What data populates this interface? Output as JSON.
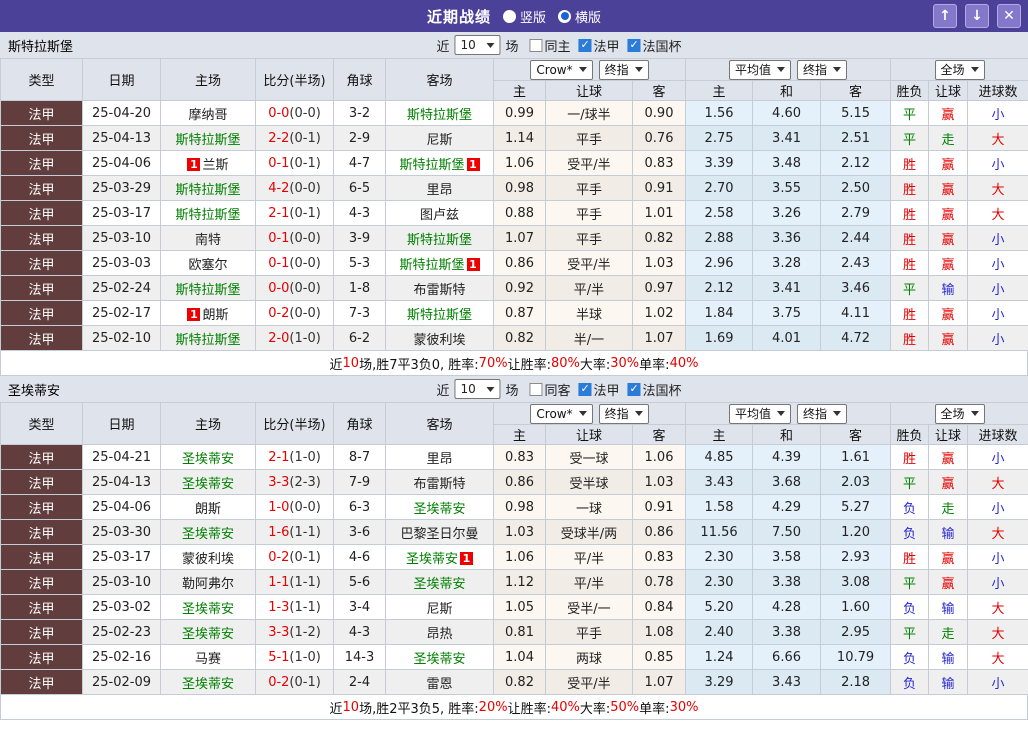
{
  "titlebar": {
    "title": "近期战绩",
    "layout_options": [
      {
        "label": "竖版",
        "selected": false
      },
      {
        "label": "横版",
        "selected": true
      }
    ],
    "buttons": {
      "up": "↑",
      "down": "↓",
      "close": "✕"
    }
  },
  "palette": {
    "accent_purple": "#4c4199",
    "type_maroon": "#613d3d",
    "win_red": "#e60000",
    "draw_green": "#008000",
    "lose_blue": "#2727d2",
    "highlight_team_green": "#008000"
  },
  "color_map": {
    "胜": "red",
    "平": "green",
    "负": "blue",
    "赢": "red",
    "走": "green",
    "输": "blue",
    "大": "red",
    "小": "blue"
  },
  "table_header": {
    "col_type": "类型",
    "col_date": "日期",
    "col_home": "主场",
    "col_score": "比分(半场)",
    "col_corner": "角球",
    "col_away": "客场",
    "sub_home": "主",
    "sub_handicap": "让球",
    "sub_away": "客",
    "sub_avg_home": "主",
    "sub_avg_draw": "和",
    "sub_avg_away": "客",
    "col_result": "胜负",
    "col_asian": "让球",
    "col_goals": "进球数"
  },
  "sections": [
    {
      "team": "斯特拉斯堡",
      "filter": {
        "prefix": "近",
        "count": "10",
        "suffix": "场",
        "checks": [
          {
            "label": "同主",
            "checked": false
          },
          {
            "label": "法甲",
            "checked": true
          },
          {
            "label": "法国杯",
            "checked": true
          }
        ]
      },
      "selects": {
        "crow": "Crow*",
        "crow_kind": "终指",
        "avg": "平均值",
        "avg_kind": "终指",
        "scope": "全场"
      },
      "rows": [
        {
          "type": "法甲",
          "date": "25-04-20",
          "home": "摩纳哥",
          "home_hl": false,
          "home_badge": "",
          "score": "0-0",
          "half": "(0-0)",
          "corner": "3-2",
          "away": "斯特拉斯堡",
          "away_hl": true,
          "away_badge": "",
          "h_home": "0.99",
          "handicap": "一/球半",
          "h_away": "0.90",
          "avg_home": "1.56",
          "avg_draw": "4.60",
          "avg_away": "5.15",
          "result": "平",
          "asian": "赢",
          "goals": "小"
        },
        {
          "type": "法甲",
          "date": "25-04-13",
          "home": "斯特拉斯堡",
          "home_hl": true,
          "home_badge": "",
          "score": "2-2",
          "half": "(0-1)",
          "corner": "2-9",
          "away": "尼斯",
          "away_hl": false,
          "away_badge": "",
          "h_home": "1.14",
          "handicap": "平手",
          "h_away": "0.76",
          "avg_home": "2.75",
          "avg_draw": "3.41",
          "avg_away": "2.51",
          "result": "平",
          "asian": "走",
          "goals": "大"
        },
        {
          "type": "法甲",
          "date": "25-04-06",
          "home": "兰斯",
          "home_hl": false,
          "home_badge": "1",
          "score": "0-1",
          "half": "(0-1)",
          "corner": "4-7",
          "away": "斯特拉斯堡",
          "away_hl": true,
          "away_badge": "1",
          "h_home": "1.06",
          "handicap": "受平/半",
          "h_away": "0.83",
          "avg_home": "3.39",
          "avg_draw": "3.48",
          "avg_away": "2.12",
          "result": "胜",
          "asian": "赢",
          "goals": "小"
        },
        {
          "type": "法甲",
          "date": "25-03-29",
          "home": "斯特拉斯堡",
          "home_hl": true,
          "home_badge": "",
          "score": "4-2",
          "half": "(0-0)",
          "corner": "6-5",
          "away": "里昂",
          "away_hl": false,
          "away_badge": "",
          "h_home": "0.98",
          "handicap": "平手",
          "h_away": "0.91",
          "avg_home": "2.70",
          "avg_draw": "3.55",
          "avg_away": "2.50",
          "result": "胜",
          "asian": "赢",
          "goals": "大"
        },
        {
          "type": "法甲",
          "date": "25-03-17",
          "home": "斯特拉斯堡",
          "home_hl": true,
          "home_badge": "",
          "score": "2-1",
          "half": "(0-1)",
          "corner": "4-3",
          "away": "图卢兹",
          "away_hl": false,
          "away_badge": "",
          "h_home": "0.88",
          "handicap": "平手",
          "h_away": "1.01",
          "avg_home": "2.58",
          "avg_draw": "3.26",
          "avg_away": "2.79",
          "result": "胜",
          "asian": "赢",
          "goals": "大"
        },
        {
          "type": "法甲",
          "date": "25-03-10",
          "home": "南特",
          "home_hl": false,
          "home_badge": "",
          "score": "0-1",
          "half": "(0-0)",
          "corner": "3-9",
          "away": "斯特拉斯堡",
          "away_hl": true,
          "away_badge": "",
          "h_home": "1.07",
          "handicap": "平手",
          "h_away": "0.82",
          "avg_home": "2.88",
          "avg_draw": "3.36",
          "avg_away": "2.44",
          "result": "胜",
          "asian": "赢",
          "goals": "小"
        },
        {
          "type": "法甲",
          "date": "25-03-03",
          "home": "欧塞尔",
          "home_hl": false,
          "home_badge": "",
          "score": "0-1",
          "half": "(0-0)",
          "corner": "5-3",
          "away": "斯特拉斯堡",
          "away_hl": true,
          "away_badge": "1",
          "h_home": "0.86",
          "handicap": "受平/半",
          "h_away": "1.03",
          "avg_home": "2.96",
          "avg_draw": "3.28",
          "avg_away": "2.43",
          "result": "胜",
          "asian": "赢",
          "goals": "小"
        },
        {
          "type": "法甲",
          "date": "25-02-24",
          "home": "斯特拉斯堡",
          "home_hl": true,
          "home_badge": "",
          "score": "0-0",
          "half": "(0-0)",
          "corner": "1-8",
          "away": "布雷斯特",
          "away_hl": false,
          "away_badge": "",
          "h_home": "0.92",
          "handicap": "平/半",
          "h_away": "0.97",
          "avg_home": "2.12",
          "avg_draw": "3.41",
          "avg_away": "3.46",
          "result": "平",
          "asian": "输",
          "goals": "小"
        },
        {
          "type": "法甲",
          "date": "25-02-17",
          "home": "朗斯",
          "home_hl": false,
          "home_badge": "1",
          "score": "0-2",
          "half": "(0-0)",
          "corner": "7-3",
          "away": "斯特拉斯堡",
          "away_hl": true,
          "away_badge": "",
          "h_home": "0.87",
          "handicap": "半球",
          "h_away": "1.02",
          "avg_home": "1.84",
          "avg_draw": "3.75",
          "avg_away": "4.11",
          "result": "胜",
          "asian": "赢",
          "goals": "小"
        },
        {
          "type": "法甲",
          "date": "25-02-10",
          "home": "斯特拉斯堡",
          "home_hl": true,
          "home_badge": "",
          "score": "2-0",
          "half": "(1-0)",
          "corner": "6-2",
          "away": "蒙彼利埃",
          "away_hl": false,
          "away_badge": "",
          "h_home": "0.82",
          "handicap": "半/一",
          "h_away": "1.07",
          "avg_home": "1.69",
          "avg_draw": "4.01",
          "avg_away": "4.72",
          "result": "胜",
          "asian": "赢",
          "goals": "小"
        }
      ],
      "summary": [
        {
          "text": "近",
          "color": "black"
        },
        {
          "text": "10",
          "color": "red"
        },
        {
          "text": "场,胜7平3负0, 胜率:",
          "color": "black"
        },
        {
          "text": "70%",
          "color": "red"
        },
        {
          "text": " 让胜率:",
          "color": "black"
        },
        {
          "text": "80%",
          "color": "red"
        },
        {
          "text": " 大率:",
          "color": "black"
        },
        {
          "text": "30%",
          "color": "red"
        },
        {
          "text": " 单率:",
          "color": "black"
        },
        {
          "text": "40%",
          "color": "red"
        }
      ]
    },
    {
      "team": "圣埃蒂安",
      "filter": {
        "prefix": "近",
        "count": "10",
        "suffix": "场",
        "checks": [
          {
            "label": "同客",
            "checked": false
          },
          {
            "label": "法甲",
            "checked": true
          },
          {
            "label": "法国杯",
            "checked": true
          }
        ]
      },
      "selects": {
        "crow": "Crow*",
        "crow_kind": "终指",
        "avg": "平均值",
        "avg_kind": "终指",
        "scope": "全场"
      },
      "rows": [
        {
          "type": "法甲",
          "date": "25-04-21",
          "home": "圣埃蒂安",
          "home_hl": true,
          "home_badge": "",
          "score": "2-1",
          "half": "(1-0)",
          "corner": "8-7",
          "away": "里昂",
          "away_hl": false,
          "away_badge": "",
          "h_home": "0.83",
          "handicap": "受一球",
          "h_away": "1.06",
          "avg_home": "4.85",
          "avg_draw": "4.39",
          "avg_away": "1.61",
          "result": "胜",
          "asian": "赢",
          "goals": "小"
        },
        {
          "type": "法甲",
          "date": "25-04-13",
          "home": "圣埃蒂安",
          "home_hl": true,
          "home_badge": "",
          "score": "3-3",
          "half": "(2-3)",
          "corner": "7-9",
          "away": "布雷斯特",
          "away_hl": false,
          "away_badge": "",
          "h_home": "0.86",
          "handicap": "受半球",
          "h_away": "1.03",
          "avg_home": "3.43",
          "avg_draw": "3.68",
          "avg_away": "2.03",
          "result": "平",
          "asian": "赢",
          "goals": "大"
        },
        {
          "type": "法甲",
          "date": "25-04-06",
          "home": "朗斯",
          "home_hl": false,
          "home_badge": "",
          "score": "1-0",
          "half": "(0-0)",
          "corner": "6-3",
          "away": "圣埃蒂安",
          "away_hl": true,
          "away_badge": "",
          "h_home": "0.98",
          "handicap": "一球",
          "h_away": "0.91",
          "avg_home": "1.58",
          "avg_draw": "4.29",
          "avg_away": "5.27",
          "result": "负",
          "asian": "走",
          "goals": "小"
        },
        {
          "type": "法甲",
          "date": "25-03-30",
          "home": "圣埃蒂安",
          "home_hl": true,
          "home_badge": "",
          "score": "1-6",
          "half": "(1-1)",
          "corner": "3-6",
          "away": "巴黎圣日尔曼",
          "away_hl": false,
          "away_badge": "",
          "h_home": "1.03",
          "handicap": "受球半/两",
          "h_away": "0.86",
          "avg_home": "11.56",
          "avg_draw": "7.50",
          "avg_away": "1.20",
          "result": "负",
          "asian": "输",
          "goals": "大"
        },
        {
          "type": "法甲",
          "date": "25-03-17",
          "home": "蒙彼利埃",
          "home_hl": false,
          "home_badge": "",
          "score": "0-2",
          "half": "(0-1)",
          "corner": "4-6",
          "away": "圣埃蒂安",
          "away_hl": true,
          "away_badge": "1",
          "h_home": "1.06",
          "handicap": "平/半",
          "h_away": "0.83",
          "avg_home": "2.30",
          "avg_draw": "3.58",
          "avg_away": "2.93",
          "result": "胜",
          "asian": "赢",
          "goals": "小"
        },
        {
          "type": "法甲",
          "date": "25-03-10",
          "home": "勒阿弗尔",
          "home_hl": false,
          "home_badge": "",
          "score": "1-1",
          "half": "(1-1)",
          "corner": "5-6",
          "away": "圣埃蒂安",
          "away_hl": true,
          "away_badge": "",
          "h_home": "1.12",
          "handicap": "平/半",
          "h_away": "0.78",
          "avg_home": "2.30",
          "avg_draw": "3.38",
          "avg_away": "3.08",
          "result": "平",
          "asian": "赢",
          "goals": "小"
        },
        {
          "type": "法甲",
          "date": "25-03-02",
          "home": "圣埃蒂安",
          "home_hl": true,
          "home_badge": "",
          "score": "1-3",
          "half": "(1-1)",
          "corner": "3-4",
          "away": "尼斯",
          "away_hl": false,
          "away_badge": "",
          "h_home": "1.05",
          "handicap": "受半/一",
          "h_away": "0.84",
          "avg_home": "5.20",
          "avg_draw": "4.28",
          "avg_away": "1.60",
          "result": "负",
          "asian": "输",
          "goals": "大"
        },
        {
          "type": "法甲",
          "date": "25-02-23",
          "home": "圣埃蒂安",
          "home_hl": true,
          "home_badge": "",
          "score": "3-3",
          "half": "(1-2)",
          "corner": "4-3",
          "away": "昂热",
          "away_hl": false,
          "away_badge": "",
          "h_home": "0.81",
          "handicap": "平手",
          "h_away": "1.08",
          "avg_home": "2.40",
          "avg_draw": "3.38",
          "avg_away": "2.95",
          "result": "平",
          "asian": "走",
          "goals": "大"
        },
        {
          "type": "法甲",
          "date": "25-02-16",
          "home": "马赛",
          "home_hl": false,
          "home_badge": "",
          "score": "5-1",
          "half": "(1-0)",
          "corner": "14-3",
          "away": "圣埃蒂安",
          "away_hl": true,
          "away_badge": "",
          "h_home": "1.04",
          "handicap": "两球",
          "h_away": "0.85",
          "avg_home": "1.24",
          "avg_draw": "6.66",
          "avg_away": "10.79",
          "result": "负",
          "asian": "输",
          "goals": "大"
        },
        {
          "type": "法甲",
          "date": "25-02-09",
          "home": "圣埃蒂安",
          "home_hl": true,
          "home_badge": "",
          "score": "0-2",
          "half": "(0-1)",
          "corner": "2-4",
          "away": "雷恩",
          "away_hl": false,
          "away_badge": "",
          "h_home": "0.82",
          "handicap": "受平/半",
          "h_away": "1.07",
          "avg_home": "3.29",
          "avg_draw": "3.43",
          "avg_away": "2.18",
          "result": "负",
          "asian": "输",
          "goals": "小"
        }
      ],
      "summary": [
        {
          "text": "近",
          "color": "black"
        },
        {
          "text": "10",
          "color": "red"
        },
        {
          "text": "场,胜2平3负5, 胜率:",
          "color": "black"
        },
        {
          "text": "20%",
          "color": "red"
        },
        {
          "text": " 让胜率:",
          "color": "black"
        },
        {
          "text": "40%",
          "color": "red"
        },
        {
          "text": " 大率:",
          "color": "black"
        },
        {
          "text": "50%",
          "color": "red"
        },
        {
          "text": " 单率:",
          "color": "black"
        },
        {
          "text": "30%",
          "color": "red"
        }
      ]
    }
  ]
}
